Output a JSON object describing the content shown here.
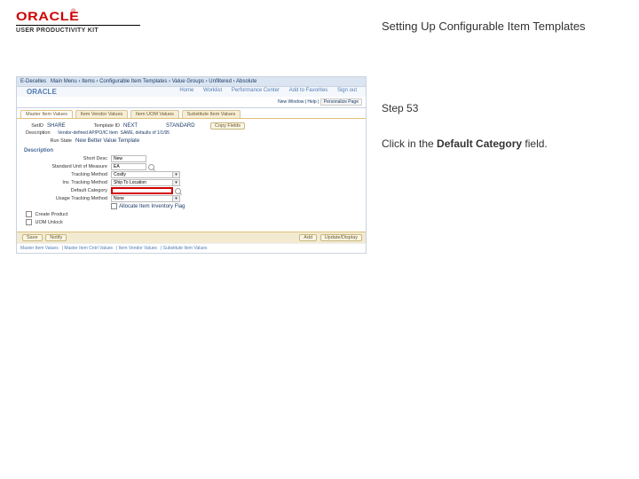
{
  "logo": {
    "brand": "ORACLE",
    "tm": "®",
    "product": "USER PRODUCTIVITY KIT"
  },
  "doc": {
    "title": "Setting Up Configurable Item Templates",
    "step_label": "Step 53",
    "instruction_prefix": "Click in the ",
    "instruction_bold": "Default Category",
    "instruction_suffix": " field."
  },
  "app": {
    "nav": {
      "i1": "E-Decelles",
      "i2": "Main Menu",
      "i3": "Items",
      "i4": "Configurable Item Templates",
      "i5": "Value Groups",
      "i6": "Unfiltered",
      "i7": "Absolute"
    },
    "brand": "ORACLE",
    "links": {
      "home": "Home",
      "worklist": "Worklist",
      "performance": "Performance Center",
      "addfav": "Add to Favorites",
      "signout": "Sign out"
    },
    "personalize": {
      "new": "New Window",
      "help": "Help",
      "pp": "Personalize Page"
    },
    "tabs": {
      "t1": "Master Item Values",
      "t2": "Item Vendor Values",
      "t3": "Item UOM Values",
      "t4": "Substitute Item Values"
    },
    "fields": {
      "setid_label": "SetID",
      "setid_val": "SHARE",
      "template_label": "Template ID",
      "template_val": "NEXT",
      "template_desc": "STANDARD",
      "copyfields_label": "Copy Fields",
      "desc1_label": "Description",
      "desc1_val": "Vendor-defined AP/PO/IC Item",
      "desc2_val": "SAME, defaults of 1/1/95",
      "runstate_label": "Run State",
      "runstate_val": "New Better Value Template",
      "desc_section": "Description",
      "shortdesc_label": "Short Desc",
      "shortdesc_val": "New",
      "stduom_label": "Standard Unit of Measure",
      "stduom_val": "EA",
      "tracking_label": "Tracking Method",
      "tracking_val": "Costly",
      "invtracking_label": "Inv. Tracking Method",
      "invtracking_val": "Ship To Location",
      "defcat_label": "Default Category",
      "defcat_val": "",
      "usage_label": "Usage Tracking Method",
      "usage_val": "None",
      "ship_chk": "Allocate Item Inventory Flag",
      "create_prod": "Create Product",
      "uom_unlock": "UOM Unlock"
    },
    "footer": {
      "save": "Save",
      "notify": "Notify",
      "add": "Add",
      "updatedisplay": "Update/Display"
    },
    "footerlinks": {
      "a": "Master Item Values",
      "b": "Master Item Cntrl Values",
      "c": "Item Vendor Values",
      "d": "Substitute Item Values"
    }
  }
}
